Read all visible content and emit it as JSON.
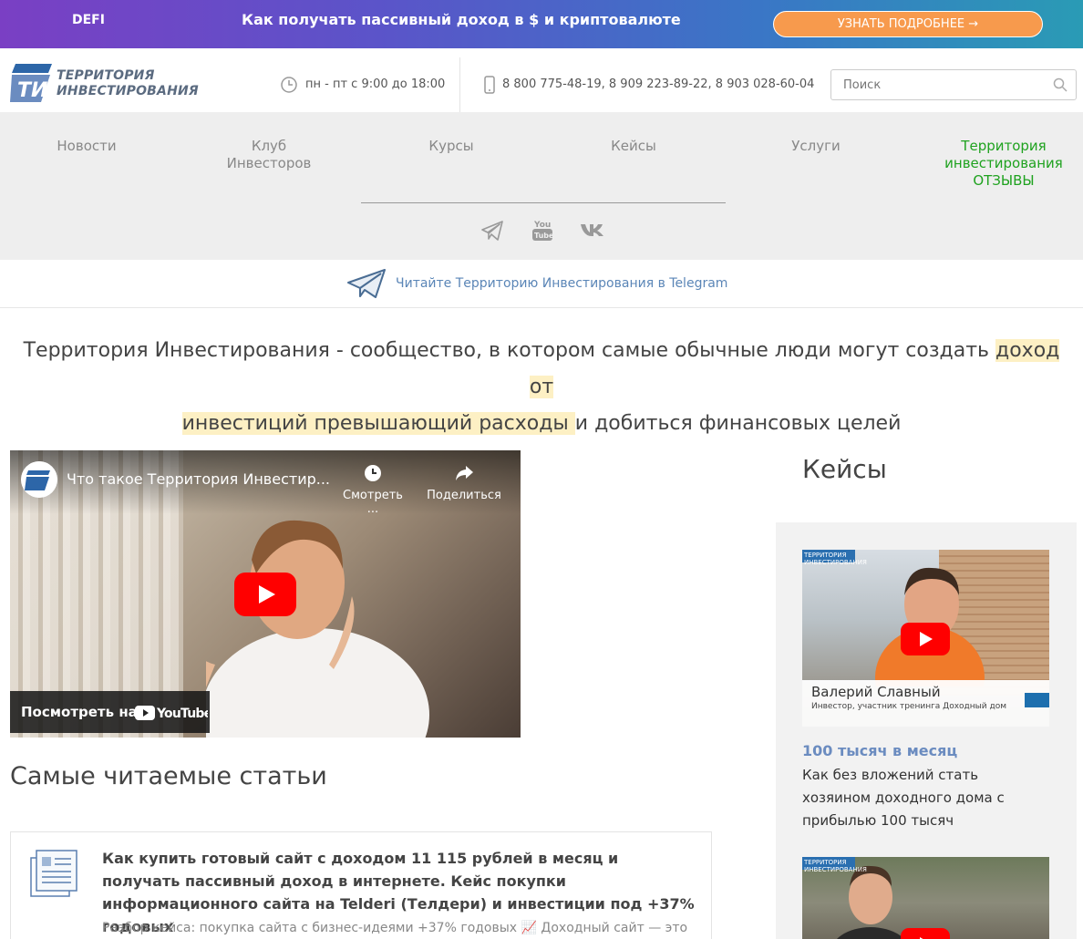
{
  "promo": {
    "tag": "DEFI",
    "headline": "Как получать пассивный доход в $ и криптовалюте",
    "cta": "УЗНАТЬ ПОДРОБНЕЕ →"
  },
  "header": {
    "logo_line1": "ТЕРРИТОРИЯ",
    "logo_line2": "ИНВЕСТИРОВАНИЯ",
    "logo_mark": "ТИ",
    "hours": "пн - пт с 9:00 до 18:00",
    "phones": "8 800 775-48-19, 8 909 223-89-22, 8 903 028-60-04",
    "search_placeholder": "Поиск"
  },
  "nav": {
    "items": [
      {
        "label": "Новости"
      },
      {
        "label": "Клуб Инвесторов"
      },
      {
        "label": "Курсы"
      },
      {
        "label": "Кейсы"
      },
      {
        "label": "Услуги"
      },
      {
        "label": "Территория инвестирования ОТЗЫВЫ"
      }
    ],
    "social": [
      "telegram-icon",
      "youtube-icon",
      "vk-icon"
    ],
    "youtube_line1": "You",
    "youtube_line2": "Tube"
  },
  "telegram_bar": {
    "text": "Читайте Территорию Инвестирования в Telegram"
  },
  "intro": {
    "part1": "Территория Инвестирования - сообщество, в котором самые обычные люди могут создать ",
    "highlight1": "доход от",
    "highlight2": "инвестиций превышающий расходы ",
    "part2": "и добиться финансовых целей"
  },
  "video": {
    "title": "Что такое Территория Инвестир...",
    "watch_later": "Смотреть ...",
    "share": "Поделиться",
    "watch_on": "Посмотреть на",
    "youtube": "YouTube"
  },
  "articles": {
    "section_title": "Самые читаемые статьи",
    "items": [
      {
        "title": "Как купить готовый сайт с доходом 11 115 рублей в месяц и получать пассивный доход в интернете. Кейс покупки информационного сайта на Telderi (Телдери) и инвестиции под +37% годовых",
        "subtitle": "Разбор кейса: покупка сайта с бизнес-идеями +37% годовых 📈 Доходный сайт — это"
      }
    ]
  },
  "sidebar": {
    "title": "Кейсы",
    "cases": [
      {
        "badge": "ТЕРРИТОРИЯ ИНВЕСТИРОВАНИЯ",
        "person_name": "Валерий Славный",
        "person_desc": "Инвестор, участник тренинга Доходный дом",
        "tag": "100 тысяч в месяц",
        "desc": "Как без вложений стать хозяином доходного дома с прибылью 100 тысяч"
      },
      {
        "badge": "ТЕРРИТОРИЯ ИНВЕСТИРОВАНИЯ"
      }
    ]
  },
  "colors": {
    "accent_orange": "#f79a4d",
    "link_blue": "#5b86b7",
    "green": "#1fa21f",
    "highlight": "#fdf0c4"
  }
}
